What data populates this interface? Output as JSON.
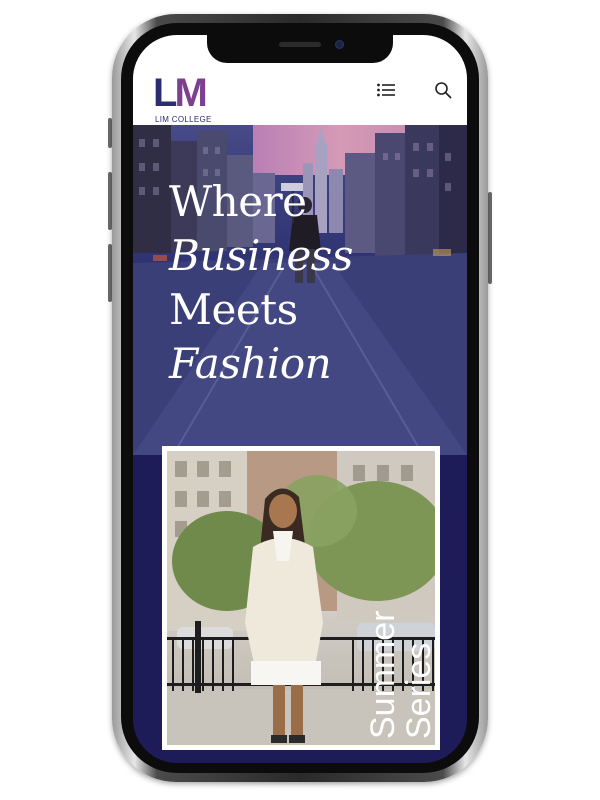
{
  "site": {
    "logo": {
      "mark_l": "L",
      "mark_m": "M",
      "tagline": "LIM COLLEGE"
    },
    "header": {
      "menu_icon": "list-menu-icon",
      "search_icon": "search-icon"
    }
  },
  "hero": {
    "line1": "Where",
    "line2": "Business",
    "line3": "Meets",
    "line4": "Fashion"
  },
  "feature": {
    "line1": "Summer",
    "line2": "Series"
  },
  "colors": {
    "brand_navy": "#2b2d6e",
    "brand_purple": "#7d3f8f",
    "hero_bottom": "#1d1c58",
    "text_on_dark": "#ffffff"
  }
}
